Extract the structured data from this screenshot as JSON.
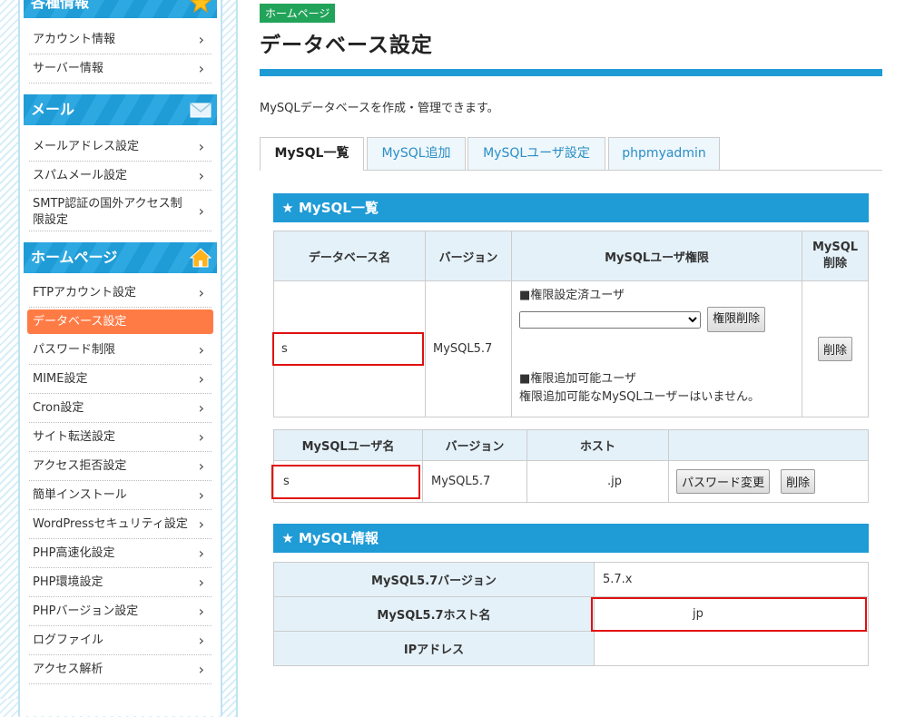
{
  "sidebar": {
    "section_info": {
      "title": "各種情報",
      "items": [
        "アカウント情報",
        "サーバー情報"
      ]
    },
    "section_mail": {
      "title": "メール",
      "items": [
        "メールアドレス設定",
        "スパムメール設定",
        "SMTP認証の国外アクセス制限設定"
      ]
    },
    "section_home": {
      "title": "ホームページ",
      "items": [
        "FTPアカウント設定",
        "データベース設定",
        "パスワード制限",
        "MIME設定",
        "Cron設定",
        "サイト転送設定",
        "アクセス拒否設定",
        "簡単インストール",
        "WordPressセキュリティ設定",
        "PHP高速化設定",
        "PHP環境設定",
        "PHPバージョン設定",
        "ログファイル",
        "アクセス解析"
      ]
    },
    "chevron": "›"
  },
  "main": {
    "tag": "ホームページ",
    "title": "データベース設定",
    "description": "MySQLデータベースを作成・管理できます。",
    "tabs": [
      "MySQL一覧",
      "MySQL追加",
      "MySQLユーザ設定",
      "phpmyadmin"
    ],
    "list_section": {
      "heading": "MySQL一覧",
      "db_table": {
        "headers": [
          "データベース名",
          "バージョン",
          "MySQLユーザ権限",
          "MySQL",
          "削除"
        ],
        "row": {
          "db_name": "s",
          "version": "MySQL5.7",
          "granted_label": "■権限設定済ユーザ",
          "revoke_button": "権限削除",
          "addable_label": "■権限追加可能ユーザ",
          "addable_none": "権限追加可能なMySQLユーザーはいません。",
          "delete_button": "削除"
        }
      },
      "user_table": {
        "headers": [
          "MySQLユーザ名",
          "バージョン",
          "ホスト"
        ],
        "row": {
          "user": "s",
          "version": "MySQL5.7",
          "host": ".jp",
          "password_button": "パスワード変更",
          "delete_button": "削除"
        }
      }
    },
    "info_section": {
      "heading": "MySQL情報",
      "rows": [
        {
          "label": "MySQL5.7バージョン",
          "value": "5.7.x"
        },
        {
          "label": "MySQL5.7ホスト名",
          "value": "jp"
        },
        {
          "label": "IPアドレス",
          "value": ""
        }
      ]
    }
  },
  "colors": {
    "accent": "#1f9bd6",
    "active": "#ff7b45",
    "highlight": "#e01010",
    "tag": "#22a35a"
  }
}
